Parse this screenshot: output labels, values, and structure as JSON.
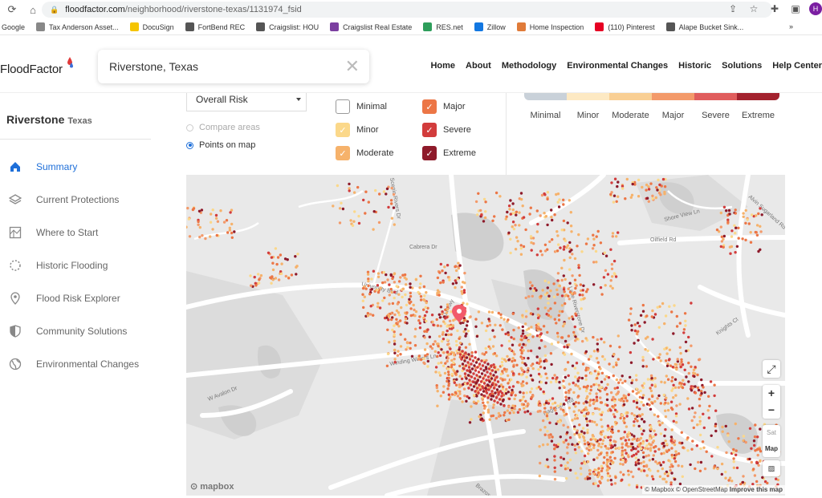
{
  "browser": {
    "url_domain": "floodfactor.com",
    "url_path": "/neighborhood/riverstone-texas/1131974_fsid",
    "avatar_letter": "H",
    "bookmarks": [
      {
        "label": "Google",
        "color": "#4285f4"
      },
      {
        "label": "Tax Anderson Asset...",
        "color": "#888888"
      },
      {
        "label": "DocuSign",
        "color": "#f5c400"
      },
      {
        "label": "FortBend REC",
        "color": "#555555"
      },
      {
        "label": "Craigslist: HOU",
        "color": "#555555"
      },
      {
        "label": "Craigslist Real Estate",
        "color": "#7b3fa0"
      },
      {
        "label": "RES.net",
        "color": "#2e9e5b"
      },
      {
        "label": "Zillow",
        "color": "#1277e1"
      },
      {
        "label": "Home Inspection",
        "color": "#e07b39"
      },
      {
        "label": "(110) Pinterest",
        "color": "#e60023"
      },
      {
        "label": "Alape Bucket Sink...",
        "color": "#555555"
      }
    ],
    "bookmarks_more": "»"
  },
  "header": {
    "logo_text": "FloodFactor",
    "search_value": "Riverstone, Texas",
    "nav": [
      "Home",
      "About",
      "Methodology",
      "Environmental Changes",
      "Historic",
      "Solutions",
      "Help Center"
    ]
  },
  "sidebar": {
    "place_name": "Riverstone",
    "place_state": "Texas",
    "items": [
      {
        "label": "Summary",
        "icon": "home-icon",
        "active": true
      },
      {
        "label": "Current Protections",
        "icon": "layers-icon",
        "active": false
      },
      {
        "label": "Where to Start",
        "icon": "map-grid-icon",
        "active": false
      },
      {
        "label": "Historic Flooding",
        "icon": "dotted-circle-icon",
        "active": false
      },
      {
        "label": "Flood Risk Explorer",
        "icon": "location-pin-icon",
        "active": false
      },
      {
        "label": "Community Solutions",
        "icon": "shield-icon",
        "active": false
      },
      {
        "label": "Environmental Changes",
        "icon": "globe-icon",
        "active": false
      }
    ]
  },
  "filters": {
    "risk_select": "Overall Risk",
    "radio_compare": "Compare areas",
    "radio_points": "Points on map",
    "checkboxes": [
      {
        "label": "Minimal",
        "color": "#ffffff",
        "checked": false
      },
      {
        "label": "Minor",
        "color": "#fbd88a",
        "checked": true
      },
      {
        "label": "Moderate",
        "color": "#f6b26b",
        "checked": true
      },
      {
        "label": "Major",
        "color": "#ec7646",
        "checked": true
      },
      {
        "label": "Severe",
        "color": "#d23c3c",
        "checked": true
      },
      {
        "label": "Extreme",
        "color": "#8e1a2a",
        "checked": true
      }
    ],
    "legend": [
      {
        "label": "Minimal",
        "color": "#c9d1d9"
      },
      {
        "label": "Minor",
        "color": "#fde9c3"
      },
      {
        "label": "Moderate",
        "color": "#f9cf94"
      },
      {
        "label": "Major",
        "color": "#f39a6a"
      },
      {
        "label": "Severe",
        "color": "#e05d5d"
      },
      {
        "label": "Extreme",
        "color": "#a3222e"
      }
    ]
  },
  "map": {
    "roads": [
      {
        "label": "University Blvd"
      },
      {
        "label": "Oilfield Rd"
      },
      {
        "label": "Cabrera Dr"
      },
      {
        "label": "Scenic Rivers Dr"
      },
      {
        "label": "Shore View Ln"
      },
      {
        "label": "Alvin Sugarland Rd"
      },
      {
        "label": "Lake Riverstone Dr"
      },
      {
        "label": "Winding Waters Ln"
      },
      {
        "label": "W Avalon Dr"
      },
      {
        "label": "Knights Ct"
      },
      {
        "label": "Hagerson Rd"
      },
      {
        "label": "Brazos River Dr"
      },
      {
        "label": "LJ Pkwy"
      }
    ],
    "controls": {
      "zoom_in": "+",
      "zoom_out": "−",
      "sat": "Sat",
      "map": "Map"
    },
    "mapbox_logo": "mapbox",
    "attribution_mapbox": "© Mapbox",
    "attribution_osm": "© OpenStreetMap",
    "attribution_improve": "Improve this map"
  }
}
